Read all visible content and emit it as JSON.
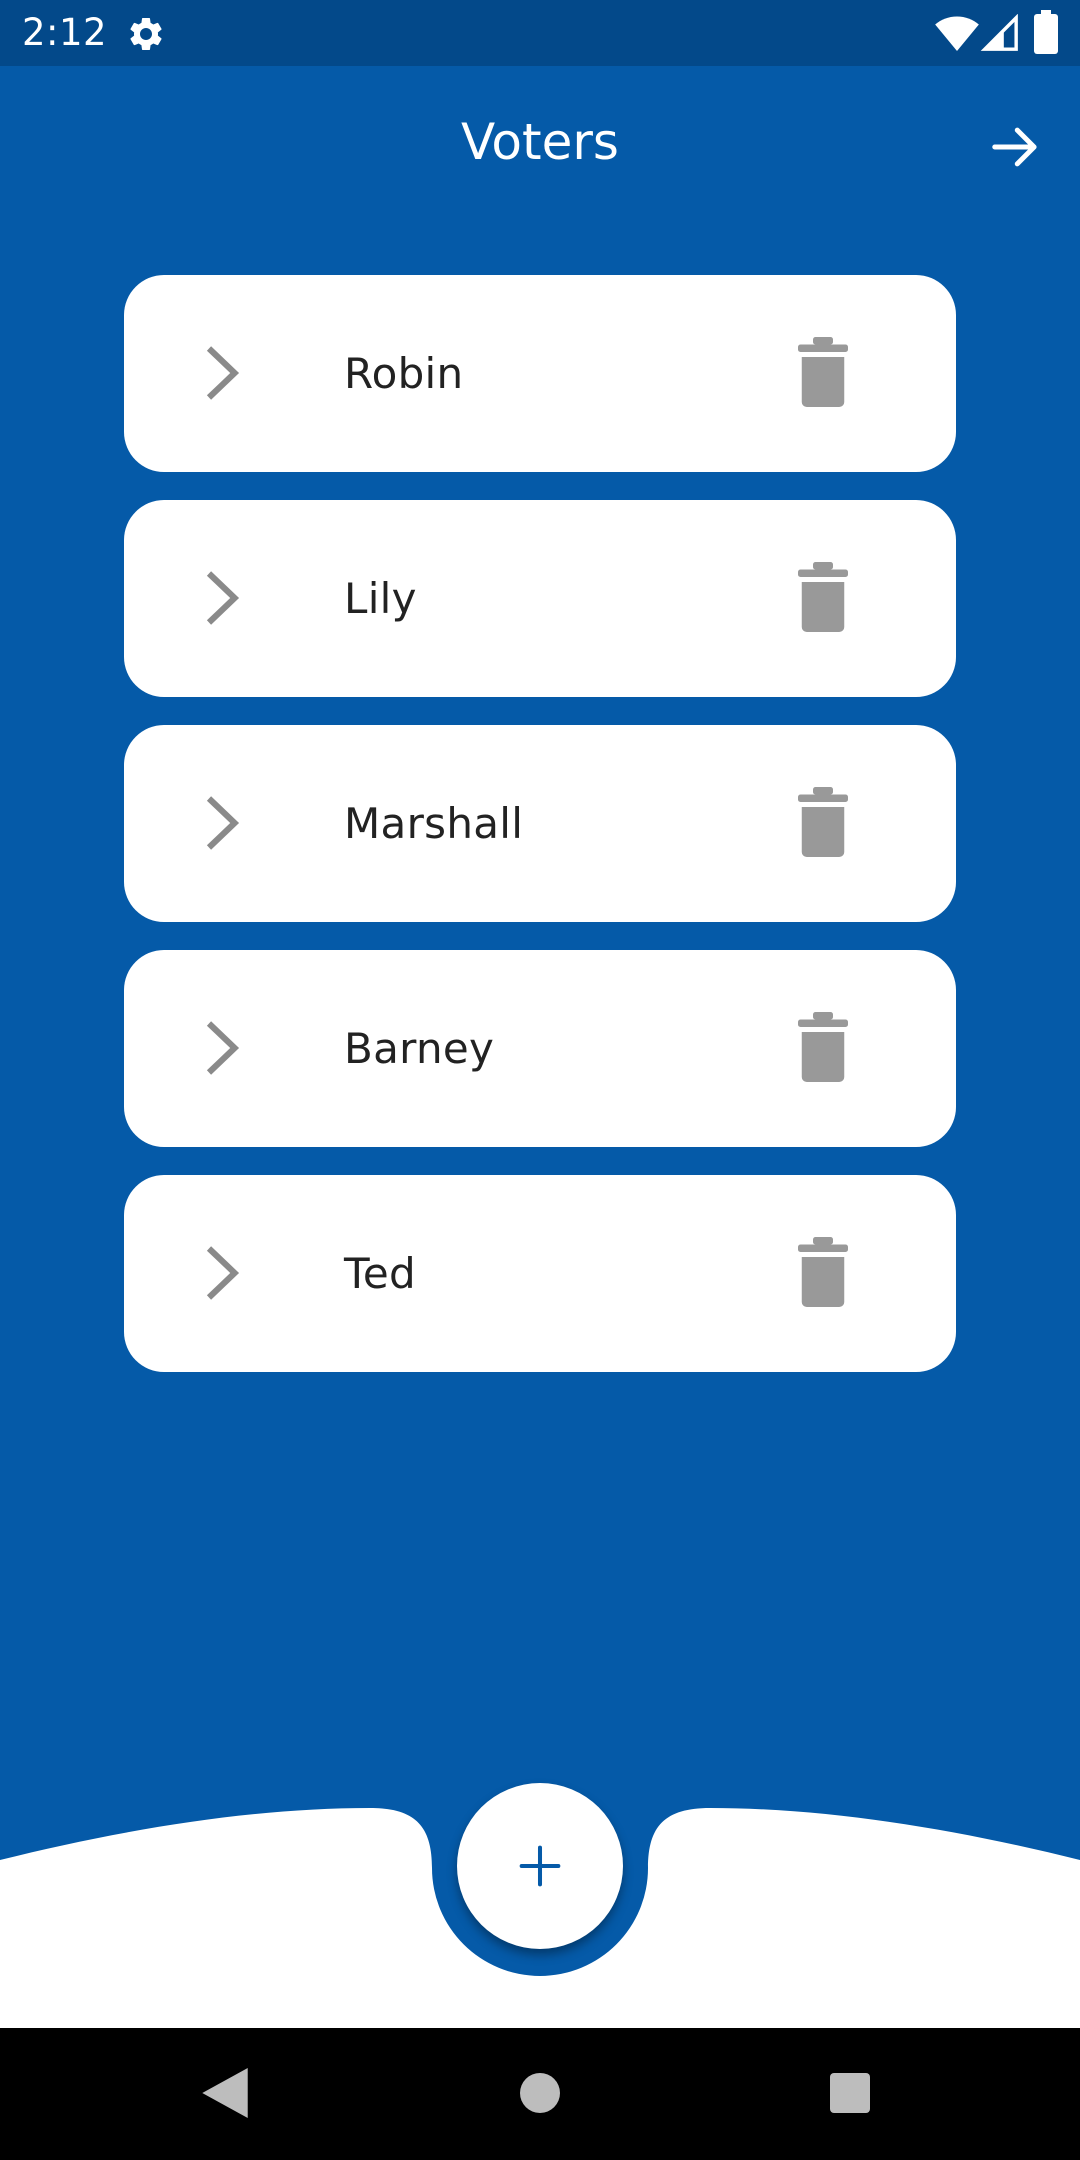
{
  "status_bar": {
    "time": "2:12"
  },
  "header": {
    "title": "Voters"
  },
  "voters": [
    {
      "name": "Robin"
    },
    {
      "name": "Lily"
    },
    {
      "name": "Marshall"
    },
    {
      "name": "Barney"
    },
    {
      "name": "Ted"
    }
  ],
  "icons": {
    "settings": "gear-icon",
    "next": "arrow-right-icon",
    "expand": "chevron-right-icon",
    "delete": "trash-icon",
    "add": "plus-icon"
  },
  "colors": {
    "primary": "#055aa8",
    "status_bar": "#03498a",
    "card": "#ffffff",
    "icon_gray": "#8a8a8a",
    "nav_bar": "#000000"
  }
}
